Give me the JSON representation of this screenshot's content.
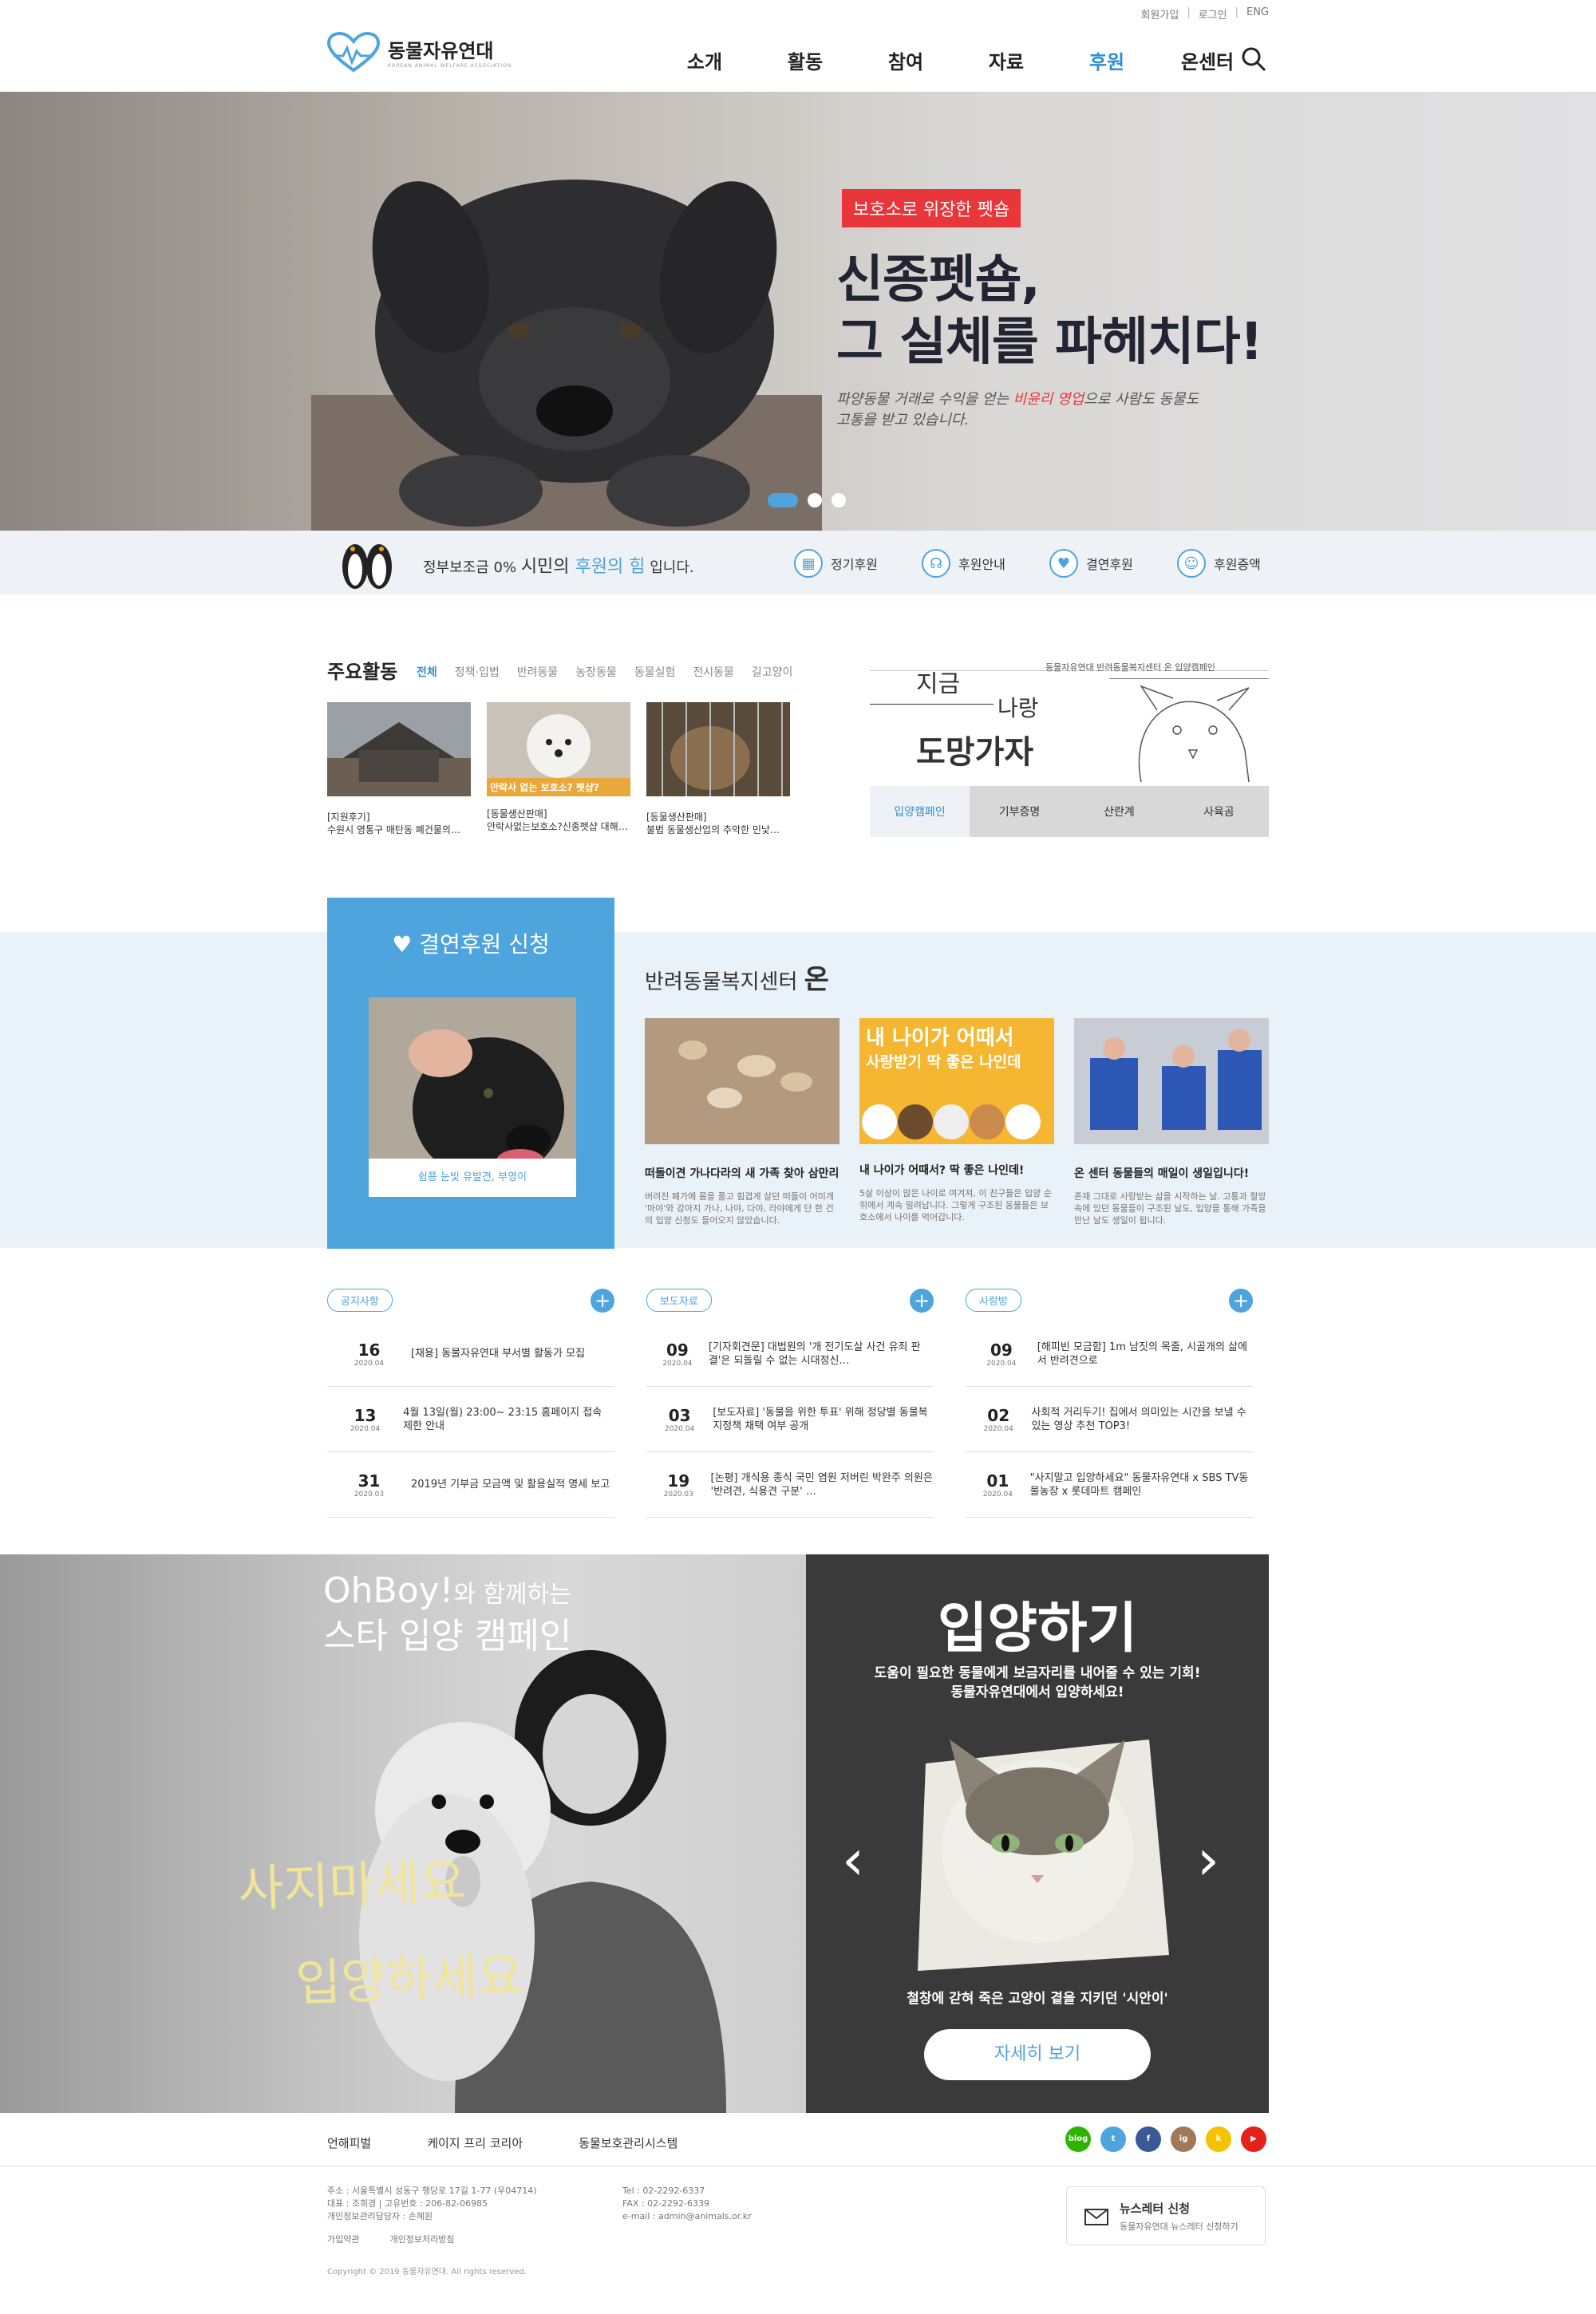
{
  "util": {
    "join": "회원가입",
    "login": "로그인",
    "lang": "ENG"
  },
  "brand": {
    "name": "동물자유연대",
    "sub": "KOREAN ANIMAL WELFARE ASSOCIATION"
  },
  "nav": [
    {
      "label": "소개",
      "active": false
    },
    {
      "label": "활동",
      "active": false
    },
    {
      "label": "참여",
      "active": false
    },
    {
      "label": "자료",
      "active": false
    },
    {
      "label": "후원",
      "active": true
    },
    {
      "label": "온센터",
      "active": false
    }
  ],
  "hero": {
    "badge": "보호소로 위장한 펫숍",
    "title1": "신종펫숍,",
    "title2": "그 실체를 파헤치다!",
    "desc_a": "파양동물 거래로 수익을 얻는 ",
    "desc_red": "비윤리 영업",
    "desc_b": "으로 사람도 동물도",
    "desc_c": "고통을 받고 있습니다.",
    "slide_count": 3,
    "active_slide": 1
  },
  "strip": {
    "pre": "정부보조금 0% ",
    "mid": "시민의 ",
    "blue": "후원의 힘",
    "post": " 입니다.",
    "links": [
      {
        "label": "정기후원",
        "icon": "calendar-icon"
      },
      {
        "label": "후원안내",
        "icon": "headset-icon"
      },
      {
        "label": "결연후원",
        "icon": "heart-icon"
      },
      {
        "label": "후원증액",
        "icon": "smile-icon"
      }
    ]
  },
  "activities": {
    "title": "주요활동",
    "tabs": [
      "전체",
      "정책·입법",
      "반려동물",
      "농장동물",
      "동물실험",
      "전시동물",
      "길고양이"
    ],
    "active_tab": 0,
    "cards": [
      {
        "cat": "[지원후기]",
        "title": "수원시 영통구 매탄동 폐건물의…"
      },
      {
        "cat": "[동물생산판매]",
        "title": "안락사없는보호소?신종펫샵 대해…",
        "overlay": "안락사 없는 보호소? 펫샵?"
      },
      {
        "cat": "[동물생산판매]",
        "title": "불법 동물생산업의 추악한 민낯…"
      }
    ]
  },
  "campaign": {
    "note": "동물자유연대 반려동물복지센터 온 입양캠페인",
    "t1": "지금",
    "t2": "나랑",
    "t3": "도망가자",
    "tabs": [
      "입양캠페인",
      "기부증명",
      "산란계",
      "사육곰"
    ],
    "active_tab": 0
  },
  "sponsor": {
    "title": "결연후원 신청",
    "caption": "쉼쭁 눈빛 유발견, 부영이"
  },
  "oncenter": {
    "title_a": "반려동물복지센터 ",
    "title_b": "온",
    "cards": [
      {
        "title": "떠돌이견 가나다라의 새 가족 찾아 삼만리",
        "desc": "버려진 폐가에 몸을 풀고 힘겹게 살던 떠돌이 어미개 '마야'와 강아지 가나, 나야, 다야, 라야에게 단 한 건의 입양 신청도 들어오지 않았습니다."
      },
      {
        "title": "내 나이가 어때서? 딱 좋은 나인데!",
        "desc": "5살 이상이 많은 나이로 여겨져, 이 친구들은 입양 순위에서 계속 밀려납니다. 그렇게 구조된 동물들은 보호소에서 나이를 먹어갑니다.",
        "overlay1": "내 나이가 어때서",
        "overlay2": "사랑받기 딱 좋은 나인데"
      },
      {
        "title": "온 센터 동물들의 매일이 생일입니다!",
        "desc": "존재 그대로 사랑받는 삶을 시작하는 날. 고통과 절망 속에 있던 동물들이 구조된 날도, 입양을 통해 가족을 만난 날도 생일이 됩니다."
      }
    ]
  },
  "news": [
    {
      "label": "공지사항",
      "items": [
        {
          "day": "16",
          "ym": "2020.04",
          "text": "[채용] 동물자유연대 부서별 활동가 모집"
        },
        {
          "day": "13",
          "ym": "2020.04",
          "text": "4월 13일(월) 23:00~ 23:15 홈페이지 접속 제한 안내"
        },
        {
          "day": "31",
          "ym": "2020.03",
          "text": "2019년 기부금 모금액 및 활용실적 명세 보고"
        }
      ]
    },
    {
      "label": "보도자료",
      "items": [
        {
          "day": "09",
          "ym": "2020.04",
          "text": "[기자회견문] 대법원의 '개 전기도살 사건 유죄 판결'은 되돌릴 수 없는 시대정신…"
        },
        {
          "day": "03",
          "ym": "2020.04",
          "text": "[보도자료] '동물을 위한 투표' 위해 정당별 동물복지정책 채택 여부 공개"
        },
        {
          "day": "19",
          "ym": "2020.03",
          "text": "[논평] 개식용 종식 국민 염원 저버린 박완주 의원은 '반려견, 식용견 구분' …"
        }
      ]
    },
    {
      "label": "사랑방",
      "items": [
        {
          "day": "09",
          "ym": "2020.04",
          "text": "[해피빈 모금함] 1m 남짓의 목줄, 시골개의 삶에서 반려견으로"
        },
        {
          "day": "02",
          "ym": "2020.04",
          "text": "사회적 거리두기! 집에서 의미있는 시간을 보낼 수 있는 영상 추천 TOP3!"
        },
        {
          "day": "01",
          "ym": "2020.04",
          "text": "\"사지말고 입양하세요\" 동물자유연대 x SBS TV동물농장 x 롯데마트 캠페인"
        }
      ]
    }
  ],
  "promo": {
    "oh_a": "OhBoy!",
    "oh_b": "와 함께하는",
    "oh_c": "스타 입양 캠페인",
    "call1": "사지마세요",
    "call2": "입양하세요",
    "adopt_title": "입양하기",
    "adopt_d1": "도움이 필요한 동물에게 보금자리를 내어줄 수 있는 기회!",
    "adopt_d2": "동물자유연대에서 입양하세요!",
    "cat_caption": "철창에 갇혀 죽은 고양이 곁을 지키던 '시안이'",
    "more": "자세히 보기"
  },
  "footer": {
    "links": [
      "언해피벌",
      "케이지 프리 코리아",
      "동물보호관리시스템"
    ],
    "social": [
      {
        "name": "blog",
        "label": "blog",
        "color": "#2db400"
      },
      {
        "name": "twitter",
        "label": "t",
        "color": "#4ea4dc"
      },
      {
        "name": "facebook",
        "label": "f",
        "color": "#3b5998"
      },
      {
        "name": "instagram",
        "label": "ig",
        "color": "#a0785a"
      },
      {
        "name": "kakao",
        "label": "k",
        "color": "#f5c200"
      },
      {
        "name": "youtube",
        "label": "▶",
        "color": "#e62117"
      }
    ],
    "addr": "주소 : 서울특별시 성동구 행당로 17길 1-77 (우04714)",
    "ceo": "대표 : 조희경  |  고유번호 : 206-82-06985",
    "privacy_officer": "개인정보관리담당자 : 손혜원",
    "tel": "Tel      : 02-2292-6337",
    "fax": "FAX    : 02-2292-6339",
    "mail": "e-mail : admin@animals.or.kr",
    "policy1": "가입약관",
    "policy2": "개인정보처리방침",
    "copyright": "Copyright © 2019 동물자유연대. All rights reserved.",
    "newsletter_title": "뉴스레터 신청",
    "newsletter_sub": "동물자유연대 뉴스레터 신청하기"
  }
}
